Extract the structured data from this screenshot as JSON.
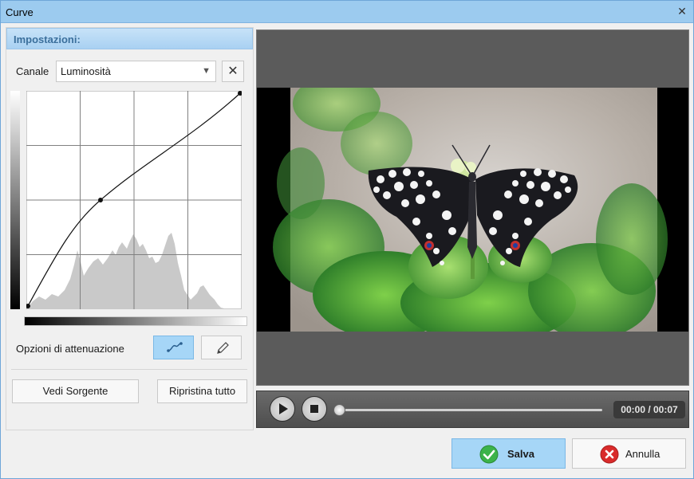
{
  "window": {
    "title": "Curve",
    "close_icon": "close-icon"
  },
  "settings": {
    "header": "Impostazioni:",
    "channel_label": "Canale",
    "channel_value": "Luminosità",
    "clear_icon": "close-icon",
    "attenuation_label": "Opzioni di attenuazione",
    "smooth_tool_icon": "smooth-curve-icon",
    "pencil_tool_icon": "pencil-icon",
    "view_source_label": "Vedi Sorgente",
    "reset_all_label": "Ripristina tutto"
  },
  "curve": {
    "points": [
      [
        0,
        0
      ],
      [
        0.34,
        0.5
      ],
      [
        1,
        1
      ]
    ],
    "grid_divisions": 4
  },
  "player": {
    "play_icon": "play-icon",
    "stop_icon": "stop-icon",
    "progress": 0,
    "time": "00:00 / 00:07"
  },
  "actions": {
    "save_label": "Salva",
    "cancel_label": "Annulla"
  },
  "colors": {
    "accent": "#a6d6f7",
    "header_text": "#3b6f9c",
    "save_icon": "#3cb34a",
    "cancel_icon": "#d92b2b"
  }
}
